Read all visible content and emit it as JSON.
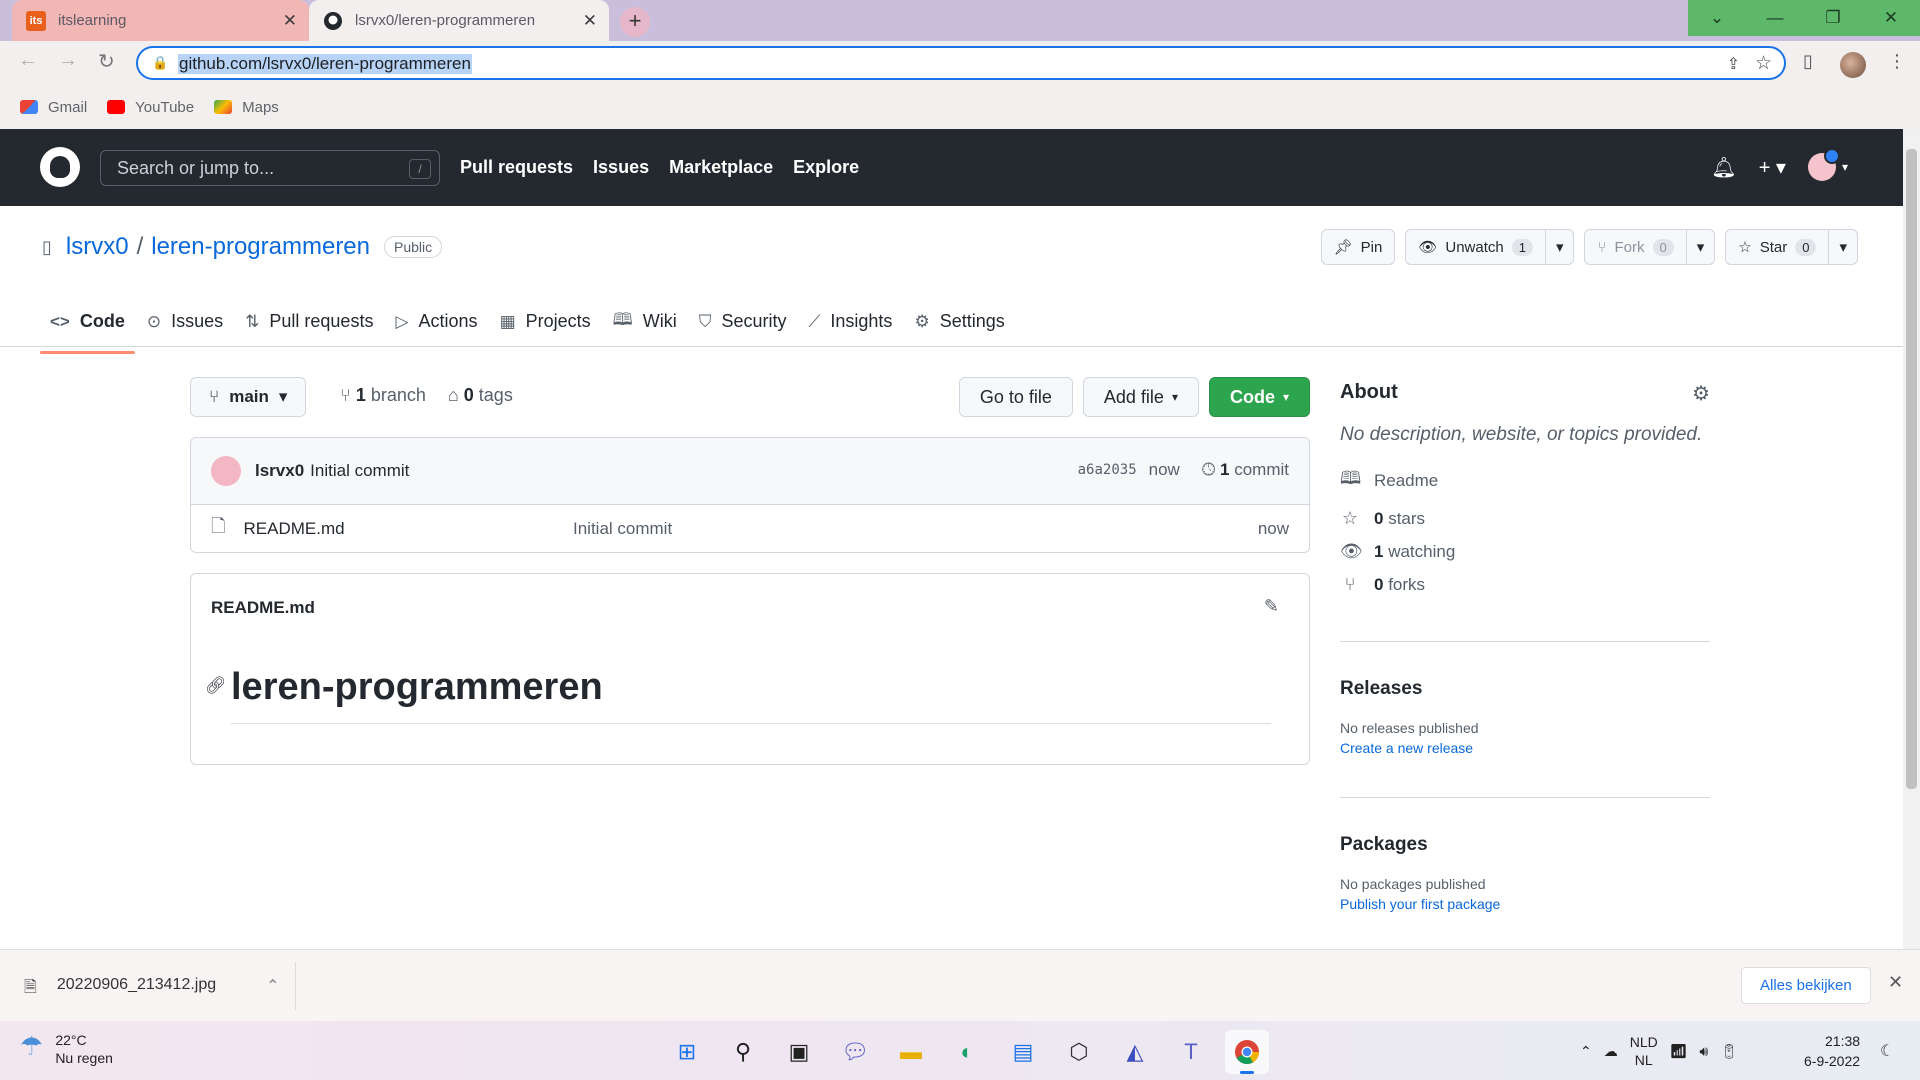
{
  "browser": {
    "tabs": [
      {
        "title": "itslearning",
        "favicon": "its"
      },
      {
        "title": "lsrvx0/leren-programmeren",
        "favicon": "github-icon"
      }
    ],
    "url": "github.com/lsrvx0/leren-programmeren",
    "bookmarks": [
      {
        "label": "Gmail"
      },
      {
        "label": "YouTube"
      },
      {
        "label": "Maps"
      }
    ]
  },
  "github": {
    "search_placeholder": "Search or jump to...",
    "search_key": "/",
    "nav": [
      "Pull requests",
      "Issues",
      "Marketplace",
      "Explore"
    ]
  },
  "repo": {
    "owner": "lsrvx0",
    "separator": "/",
    "name": "leren-programmeren",
    "visibility": "Public",
    "actions": {
      "pin": "Pin",
      "unwatch": "Unwatch",
      "watch_count": "1",
      "fork": "Fork",
      "fork_count": "0",
      "star": "Star",
      "star_count": "0"
    },
    "tabs": [
      "Code",
      "Issues",
      "Pull requests",
      "Actions",
      "Projects",
      "Wiki",
      "Security",
      "Insights",
      "Settings"
    ]
  },
  "code": {
    "branch": "main",
    "branch_count": "1",
    "branch_label": "branch",
    "tag_count": "0",
    "tag_label": "tags",
    "go_to_file": "Go to file",
    "add_file": "Add file",
    "code_button": "Code",
    "commit": {
      "author": "lsrvx0",
      "message": "Initial commit",
      "sha": "a6a2035",
      "time": "now",
      "commit_count": "1",
      "commit_label": "commit"
    },
    "files": [
      {
        "name": "README.md",
        "message": "Initial commit",
        "time": "now"
      }
    ],
    "readme": {
      "filename": "README.md",
      "heading": "leren-programmeren"
    }
  },
  "sidebar": {
    "about_title": "About",
    "description": "No description, website, or topics provided.",
    "readme": "Readme",
    "stars_count": "0",
    "stars_label": "stars",
    "watching_count": "1",
    "watching_label": "watching",
    "forks_count": "0",
    "forks_label": "forks",
    "releases_title": "Releases",
    "releases_text": "No releases published",
    "releases_link": "Create a new release",
    "packages_title": "Packages",
    "packages_text": "No packages published",
    "packages_link": "Publish your first package"
  },
  "downloads": {
    "file": "20220906_213412.jpg",
    "show_all": "Alles bekijken"
  },
  "taskbar": {
    "temperature": "22°C",
    "weather": "Nu regen",
    "lang_top": "NLD",
    "lang_bottom": "NL",
    "time": "21:38",
    "date": "6-9-2022"
  }
}
